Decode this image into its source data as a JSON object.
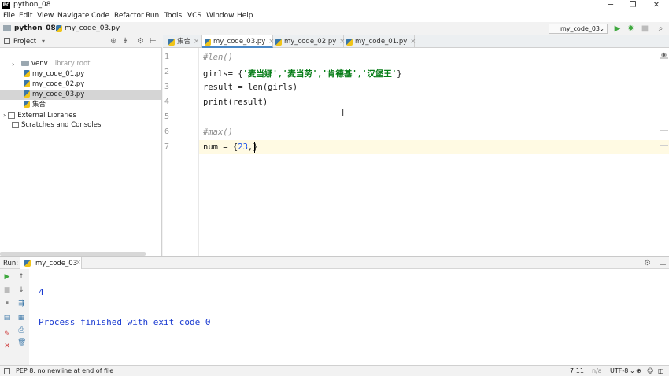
{
  "window": {
    "title": "python_08",
    "controls": [
      "─",
      "❐",
      "✕"
    ]
  },
  "menu": [
    "File",
    "Edit",
    "View",
    "Navigate",
    "Code",
    "Refactor",
    "Run",
    "Tools",
    "VCS",
    "Window",
    "Help"
  ],
  "breadcrumb": {
    "project": "python_08",
    "file": "my_code_03.py"
  },
  "run_config": "my_code_03",
  "project_panel": {
    "title": "Project",
    "tree": [
      {
        "label": "venv",
        "suffix": "library root",
        "kind": "folder"
      },
      {
        "label": "my_code_01.py",
        "kind": "py"
      },
      {
        "label": "my_code_02.py",
        "kind": "py"
      },
      {
        "label": "my_code_03.py",
        "kind": "py",
        "selected": true
      },
      {
        "label": "集合",
        "kind": "py"
      },
      {
        "label": "External Libraries",
        "kind": "lib"
      },
      {
        "label": "Scratches and Consoles",
        "kind": "lib"
      }
    ]
  },
  "tabs": [
    {
      "label": "集合"
    },
    {
      "label": "my_code_03.py",
      "active": true
    },
    {
      "label": "my_code_02.py"
    },
    {
      "label": "my_code_01.py"
    }
  ],
  "editor": {
    "lines": [
      {
        "n": "1",
        "a": "#len()"
      },
      {
        "n": "2",
        "a": "girls= {",
        "b": "'麦当娜','麦当劳','肯德基','汉堡王'",
        "c": "}"
      },
      {
        "n": "3",
        "a": "result = len(girls)"
      },
      {
        "n": "4",
        "a": "print(result)"
      },
      {
        "n": "5",
        "a": ""
      },
      {
        "n": "6",
        "a": "#max()"
      },
      {
        "n": "7",
        "a": "num = {",
        "b": "23",
        "c": ",}"
      }
    ]
  },
  "run_panel": {
    "label": "Run:",
    "tab": "my_code_03",
    "output": [
      "4",
      "Process finished with exit code 0"
    ]
  },
  "status": {
    "message": "PEP 8: no newline at end of file",
    "position": "7:11",
    "na": "n/a",
    "encoding": "UTF-8"
  }
}
